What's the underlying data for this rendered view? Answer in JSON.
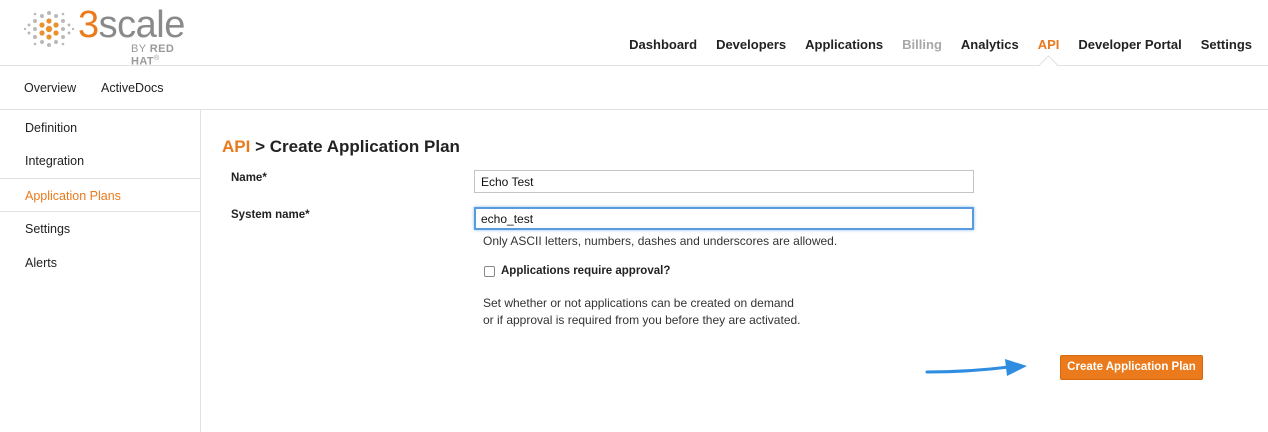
{
  "brand": {
    "logo_word_three": "3",
    "logo_word_rest": "scale",
    "logo_sub_by": "BY ",
    "logo_sub_redhat": "RED HAT",
    "logo_sub_mark": "®",
    "accent_color": "#ea7a1b",
    "logo_icon": "dot-cluster-logo-icon"
  },
  "main_nav": {
    "items": [
      {
        "label": "Dashboard",
        "state": "normal"
      },
      {
        "label": "Developers",
        "state": "normal"
      },
      {
        "label": "Applications",
        "state": "normal"
      },
      {
        "label": "Billing",
        "state": "disabled"
      },
      {
        "label": "Analytics",
        "state": "normal"
      },
      {
        "label": "API",
        "state": "active"
      },
      {
        "label": "Developer Portal",
        "state": "normal"
      },
      {
        "label": "Settings",
        "state": "normal"
      }
    ]
  },
  "sub_nav": {
    "items": [
      {
        "label": "Overview"
      },
      {
        "label": "ActiveDocs"
      }
    ]
  },
  "sidebar": {
    "items": [
      {
        "label": "Definition",
        "active": false
      },
      {
        "label": "Integration",
        "active": false
      },
      {
        "label": "Application Plans",
        "active": true
      },
      {
        "label": "Settings",
        "active": false
      },
      {
        "label": "Alerts",
        "active": false
      }
    ]
  },
  "page": {
    "breadcrumb": "API",
    "separator": " > ",
    "title": "Create Application Plan"
  },
  "form": {
    "name_label": "Name*",
    "name_value": "Echo Test",
    "system_name_label": "System name*",
    "system_name_value": "echo_test",
    "system_name_hint": "Only ASCII letters, numbers, dashes and underscores are allowed.",
    "approval_label": "Applications require approval?",
    "approval_checked": false,
    "approval_desc_line1": "Set whether or not applications can be created on demand",
    "approval_desc_line2": "or if approval is required from you before they are activated.",
    "submit_label": "Create Application Plan",
    "arrow_icon": "blue-arrow-pointer-icon",
    "arrow_color": "#2e8de0"
  }
}
